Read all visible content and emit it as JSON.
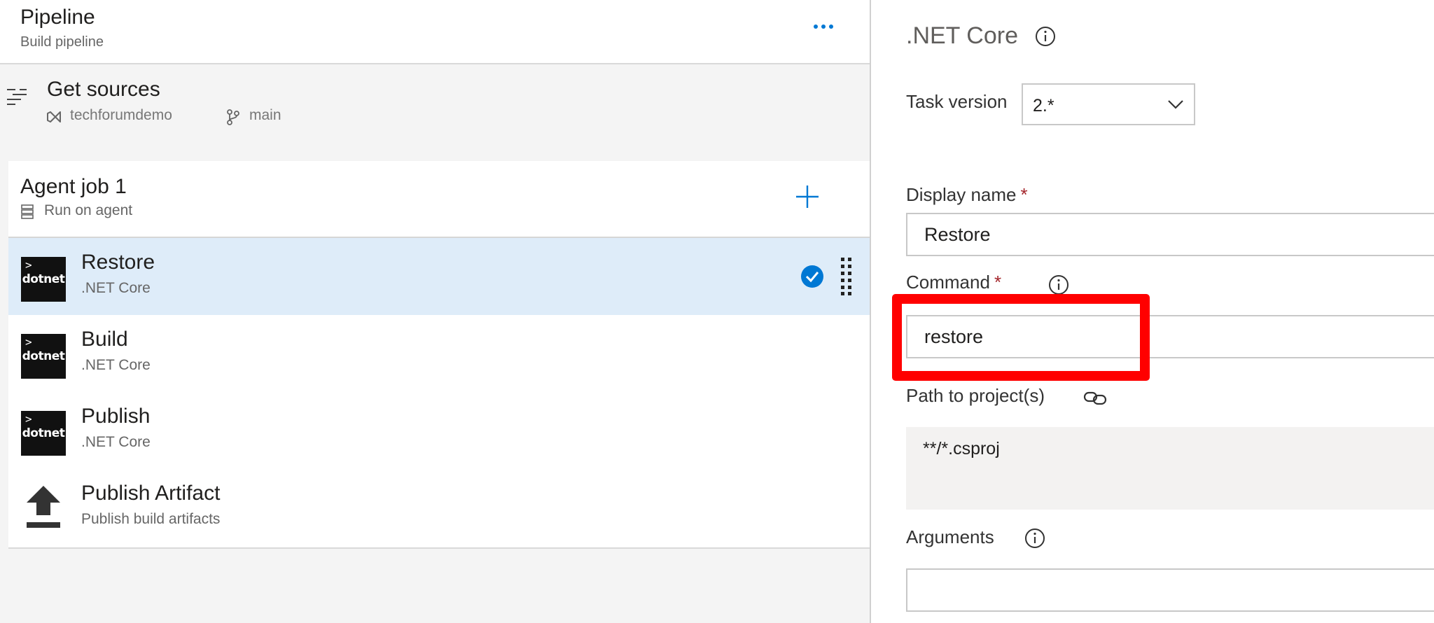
{
  "pipeline": {
    "title": "Pipeline",
    "subtitle": "Build pipeline",
    "more_icon": "more-dots-icon"
  },
  "get_sources": {
    "title": "Get sources",
    "repo": "techforumdemo",
    "branch": "main",
    "icon": "sources-list-icon"
  },
  "agent_job": {
    "title": "Agent job 1",
    "subtitle": "Run on agent",
    "add_icon": "plus-icon"
  },
  "tasks": [
    {
      "name": "Restore",
      "type": ".NET Core",
      "logo_text": "dotnet",
      "selected": true
    },
    {
      "name": "Build",
      "type": ".NET Core",
      "logo_text": "dotnet",
      "selected": false
    },
    {
      "name": "Publish",
      "type": ".NET Core",
      "logo_text": "dotnet",
      "selected": false
    },
    {
      "name": "Publish Artifact",
      "type": "Publish build artifacts",
      "icon": "upload-icon",
      "selected": false
    }
  ],
  "details": {
    "heading": ".NET Core",
    "task_version": {
      "label": "Task version",
      "value": "2.*"
    },
    "display_name": {
      "label": "Display name",
      "value": "Restore",
      "required": "*"
    },
    "command": {
      "label": "Command",
      "value": "restore",
      "required": "*"
    },
    "path_to_projects": {
      "label": "Path to project(s)",
      "value": "**/*.csproj"
    },
    "arguments": {
      "label": "Arguments",
      "value": ""
    }
  },
  "colors": {
    "accent": "#0078d4",
    "selected_row": "#deecf9",
    "highlight": "#ff0000",
    "required": "#a4262c"
  }
}
